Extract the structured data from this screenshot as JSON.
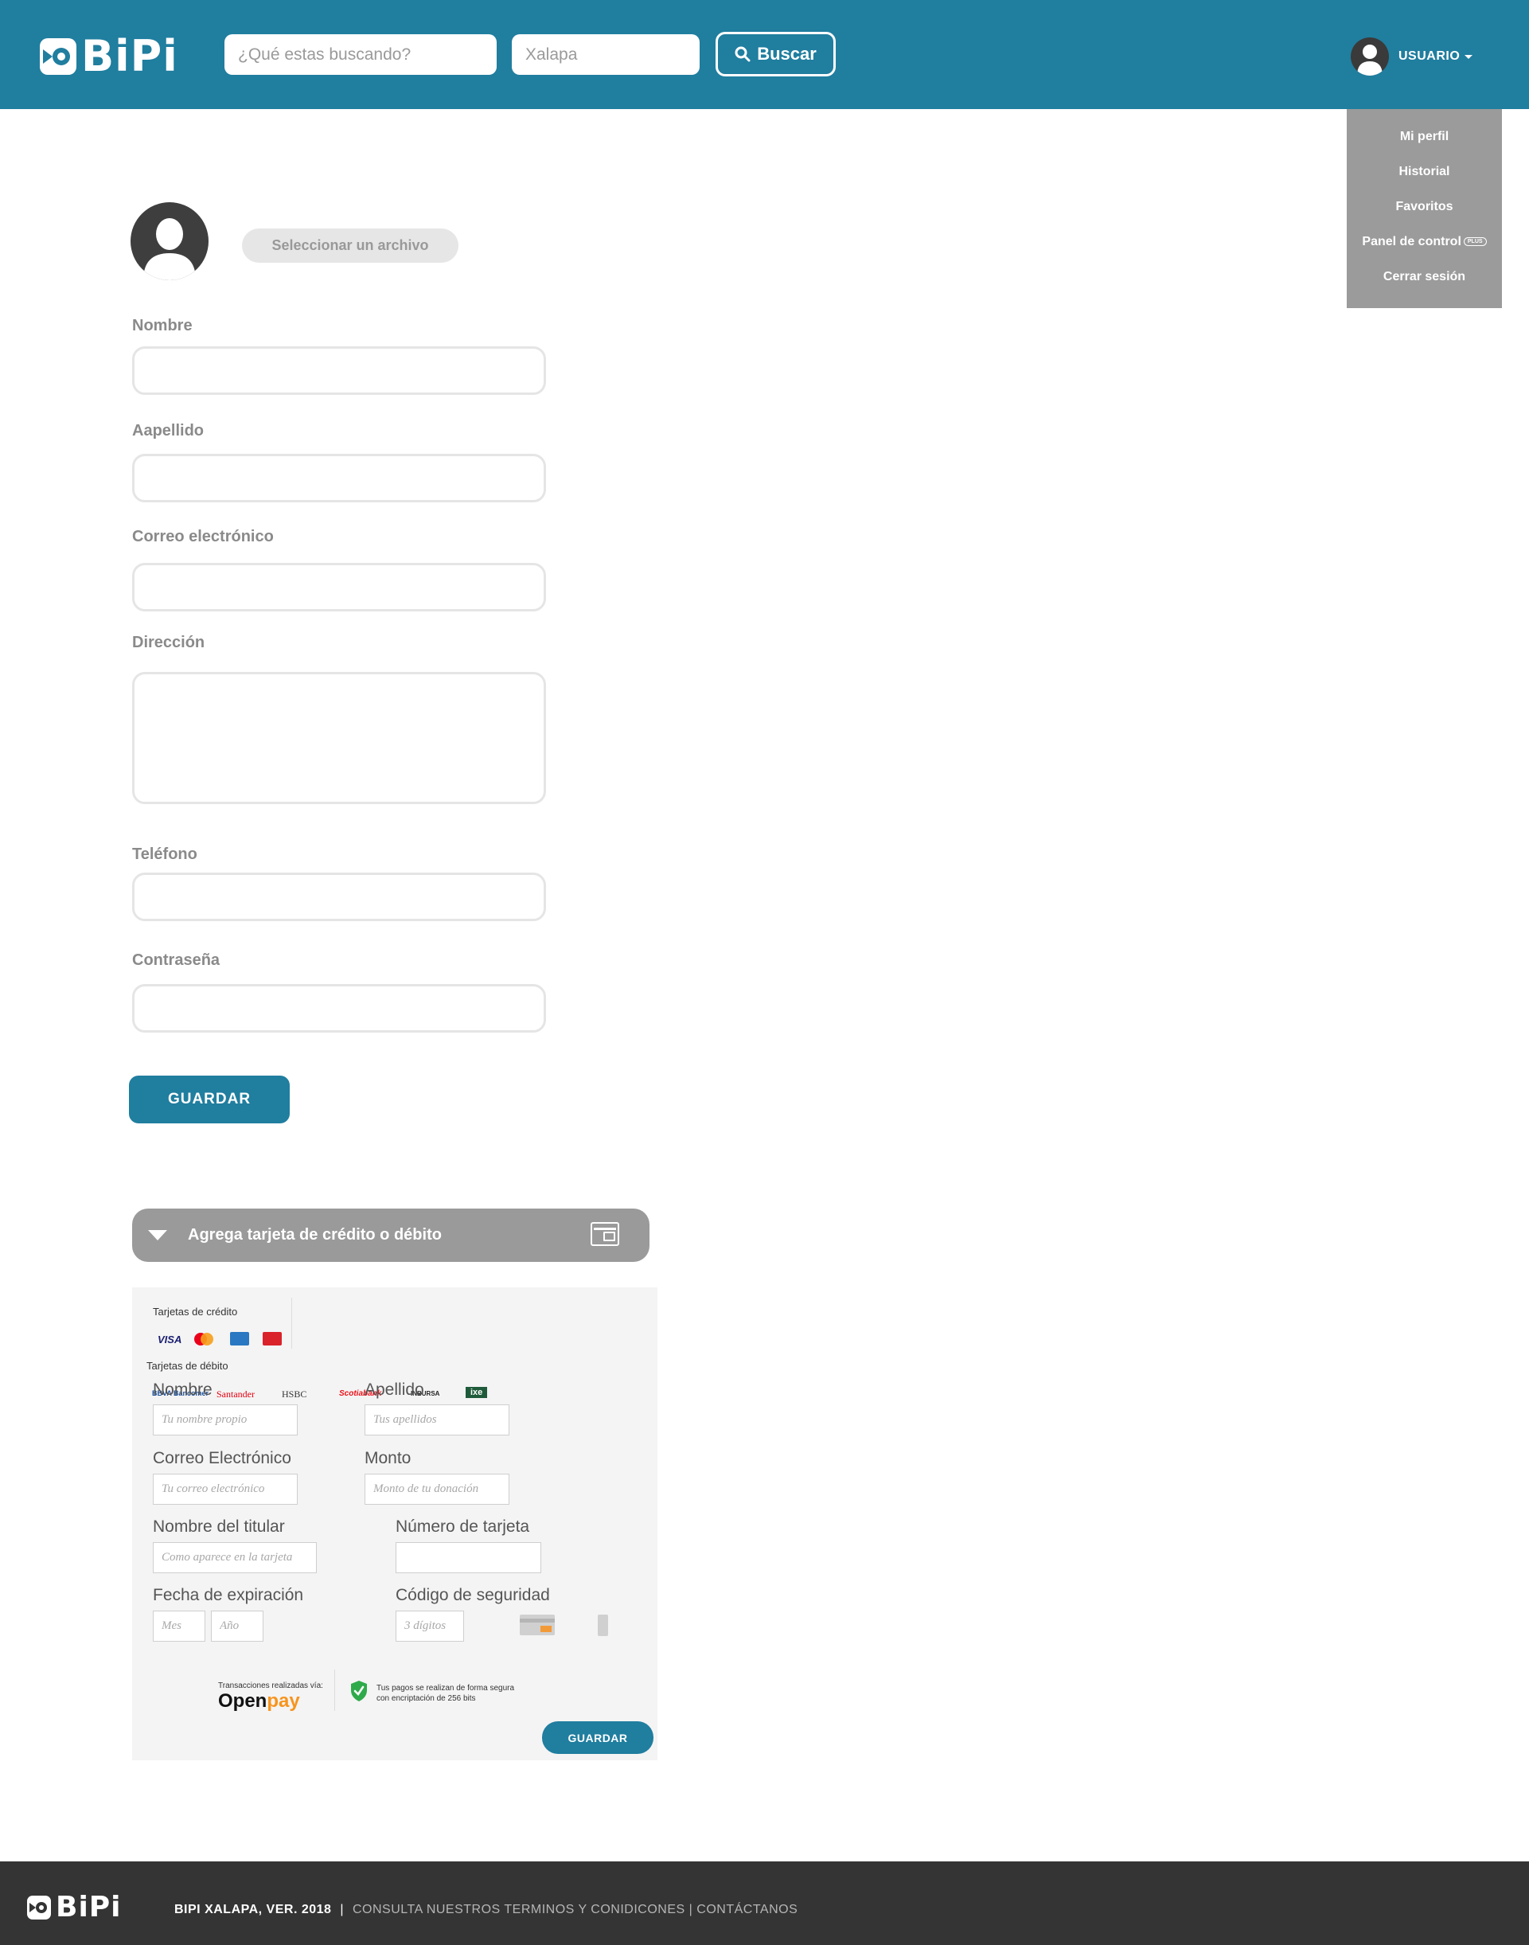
{
  "header": {
    "logo_text": "BiPi",
    "search_placeholder": "¿Qué estas buscando?",
    "city_value": "Xalapa",
    "search_button": "Buscar",
    "user_label": "USUARIO"
  },
  "user_menu": {
    "items": [
      "Mi perfil",
      "Historial",
      "Favoritos",
      "Panel de control",
      "Cerrar sesión"
    ],
    "plus_badge": "PLUS"
  },
  "profile": {
    "file_button": "Seleccionar un archivo",
    "fields": {
      "nombre": "Nombre",
      "apellido": "Aapellido",
      "correo": "Correo electrónico",
      "direccion": "Dirección",
      "telefono": "Teléfono",
      "contrasena": "Contraseña"
    },
    "save_button": "GUARDAR"
  },
  "card_section": {
    "title": "Agrega tarjeta de crédito o débito",
    "credit_heading": "Tarjetas de crédito",
    "debit_heading": "Tarjetas de débito",
    "credit_brands": [
      "VISA",
      "MasterCard",
      "American Express",
      "Carnet"
    ],
    "debit_brands": [
      "BBVA Bancomer",
      "Santander",
      "HSBC",
      "Scotiabank",
      "INBURSA",
      "ixe"
    ],
    "form": {
      "nombre_label": "Nombre",
      "nombre_placeholder": "Tu nombre propio",
      "apellido_label": "Apellido",
      "apellido_placeholder": "Tus apellidos",
      "correo_label": "Correo Electrónico",
      "correo_placeholder": "Tu correo electrónico",
      "monto_label": "Monto",
      "monto_placeholder": "Monto de tu donación",
      "titular_label": "Nombre del titular",
      "titular_placeholder": "Como aparece en la tarjeta",
      "numero_label": "Número de tarjeta",
      "numero_placeholder": "",
      "expiracion_label": "Fecha de expiración",
      "mes_placeholder": "Mes",
      "anio_placeholder": "Año",
      "codigo_label": "Código de seguridad",
      "codigo_placeholder": "3 dígitos"
    },
    "openpay_note": "Transacciones realizadas vía:",
    "openpay_logo_open": "Open",
    "openpay_logo_pay": "pay",
    "secure_note_line1": "Tus pagos se realizan de forma segura",
    "secure_note_line2": "con encriptación de 256 bits",
    "save_button": "GUARDAR"
  },
  "footer": {
    "logo_text": "BiPi",
    "version": "BIPI XALAPA, VER.  2018",
    "separator": "|",
    "terms_link": "CONSULTA NUESTROS TERMINOS Y CONIDICONES",
    "link_separator": "|",
    "contact_link": "CONTÁCTANOS"
  },
  "colors": {
    "brand_blue": "#207e9f",
    "menu_gray": "#9b9b9b",
    "footer_dark": "#343434"
  }
}
